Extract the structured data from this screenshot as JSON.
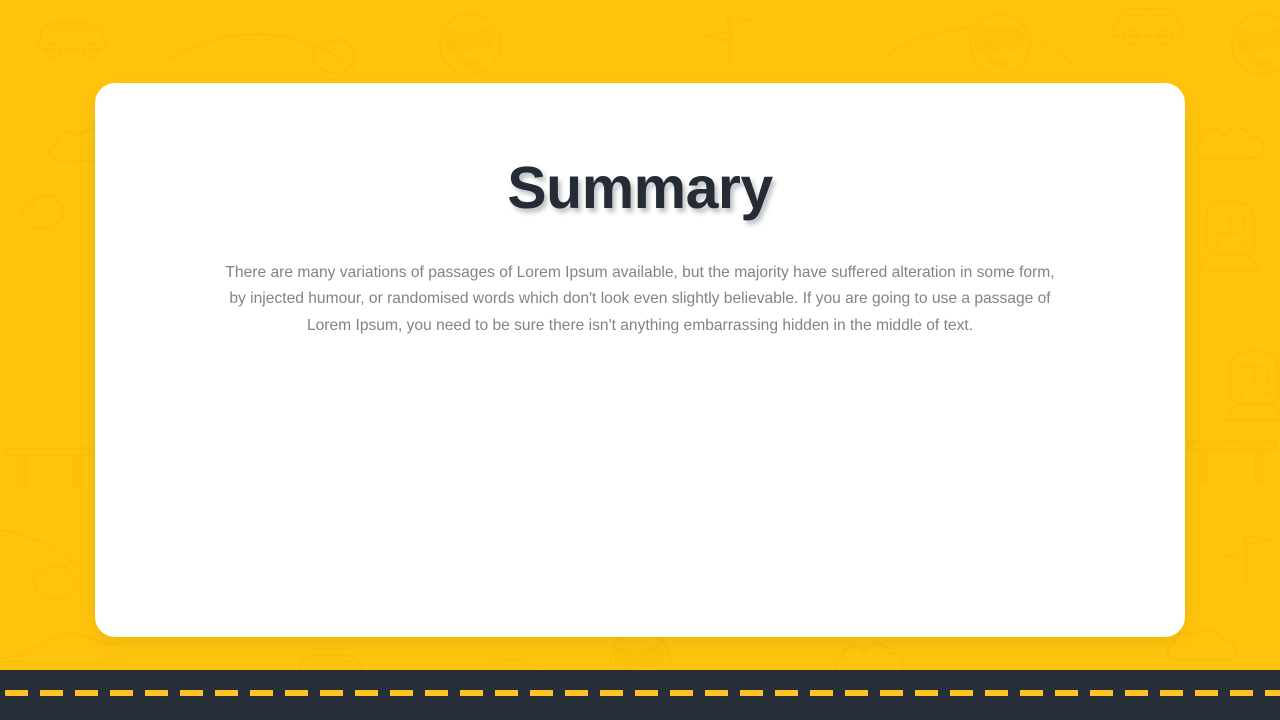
{
  "slide": {
    "title": "Summary",
    "body": "There are many variations of passages of Lorem Ipsum available, but the majority have suffered alteration in some form, by injected humour, or randomised words which don't look even slightly believable. If you are going to use a passage of Lorem Ipsum, you need to be sure there isn't anything embarrassing hidden in the middle of text."
  },
  "colors": {
    "background_yellow": "#FFC50D",
    "card_white": "#FFFFFF",
    "title_dark": "#252C36",
    "body_gray": "#818386",
    "road_dark": "#272E38",
    "road_dash_yellow": "#FFC424",
    "doodle_pattern": "#F2B500"
  },
  "decor": {
    "background_pattern_name": "travel-doodle-pattern",
    "road_strip_name": "road-strip",
    "road_dash_count": 37
  }
}
